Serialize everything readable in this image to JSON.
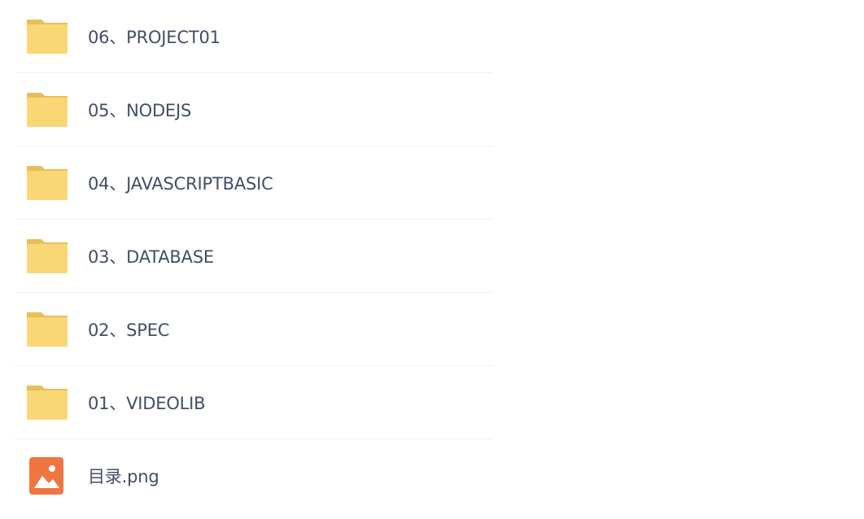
{
  "file_list": {
    "items": [
      {
        "name": "06、PROJECT01",
        "type": "folder",
        "icon": "folder-icon"
      },
      {
        "name": "05、NODEJS",
        "type": "folder",
        "icon": "folder-icon"
      },
      {
        "name": "04、JAVASCRIPTBASIC",
        "type": "folder",
        "icon": "folder-icon"
      },
      {
        "name": "03、DATABASE",
        "type": "folder",
        "icon": "folder-icon"
      },
      {
        "name": "02、SPEC",
        "type": "folder",
        "icon": "folder-icon"
      },
      {
        "name": "01、VIDEOLIB",
        "type": "folder",
        "icon": "folder-icon"
      },
      {
        "name": "目录.png",
        "type": "image",
        "icon": "image-file-icon"
      }
    ]
  },
  "colors": {
    "folder_body": "#f9d774",
    "folder_tab": "#e6be5a",
    "image_icon": "#f0763f",
    "text": "#424e67",
    "divider": "#f0f0f2"
  }
}
